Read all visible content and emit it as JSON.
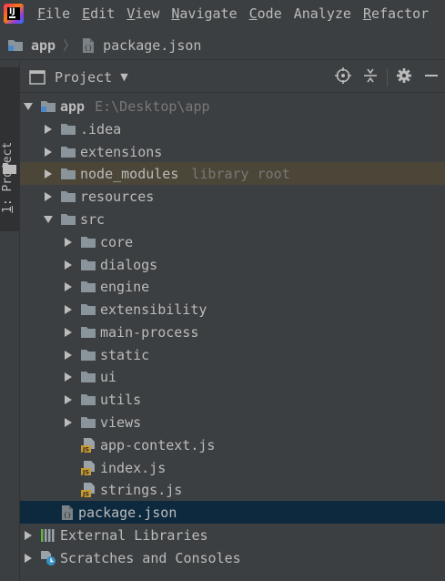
{
  "menu": {
    "items": [
      {
        "mnemonic": "F",
        "rest": "ile"
      },
      {
        "mnemonic": "E",
        "rest": "dit"
      },
      {
        "mnemonic": "V",
        "rest": "iew"
      },
      {
        "mnemonic": "N",
        "rest": "avigate"
      },
      {
        "mnemonic": "C",
        "rest": "ode"
      },
      {
        "mnemonic": "",
        "rest": "Analyze"
      },
      {
        "mnemonic": "R",
        "rest": "efactor"
      }
    ]
  },
  "breadcrumb": {
    "project": "app",
    "file": "package.json"
  },
  "stripe": {
    "mnemonic": "1",
    "rest": ": Project"
  },
  "toolwindow": {
    "title": "Project"
  },
  "tree": {
    "root": {
      "name": "app",
      "path": "E:\\Desktop\\app"
    },
    "idea": ".idea",
    "extensions": "extensions",
    "node_modules": {
      "name": "node_modules",
      "hint": "library root"
    },
    "resources": "resources",
    "src": "src",
    "core": "core",
    "dialogs": "dialogs",
    "engine": "engine",
    "extensibility": "extensibility",
    "main_process": "main-process",
    "static": "static",
    "ui": "ui",
    "utils": "utils",
    "views": "views",
    "app_context": "app-context.js",
    "index": "index.js",
    "strings": "strings.js",
    "package_json": "package.json",
    "external_libraries": "External Libraries",
    "scratches": "Scratches and Consoles"
  },
  "colors": {
    "background": "#3c3f41",
    "selection": "#0d293e",
    "library_root_highlight": "#4b4637",
    "folder": "#8a949b",
    "js_badge": "#c99a30",
    "text": "#bbbbbb",
    "hint": "#787878"
  },
  "icons": {
    "logo": "intellij-logo-icon",
    "folder": "folder-icon",
    "module": "module-folder-icon",
    "js": "javascript-file-icon",
    "json": "json-file-icon",
    "libraries": "external-libraries-icon",
    "scratches": "scratches-icon",
    "locate": "locate-icon",
    "collapse": "collapse-all-icon",
    "settings": "gear-icon",
    "hide": "hide-icon"
  }
}
